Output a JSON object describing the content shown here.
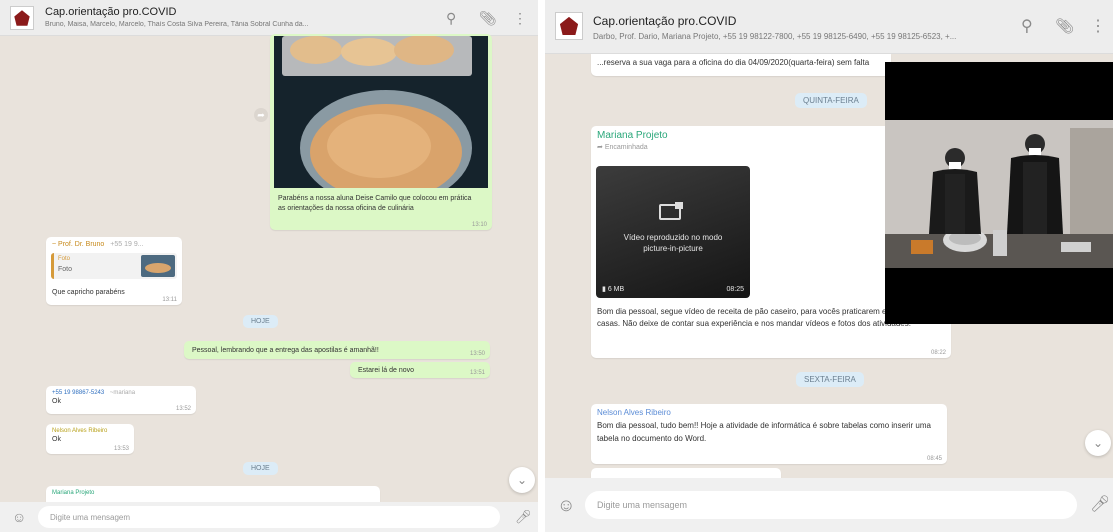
{
  "left": {
    "header": {
      "title": "Cap.orientação pro.COVID",
      "subtitle": "Bruno, Maisa, Marcelo, Marcelo, Thaís Costa Silva Pereira, Tânia Sobral Cunha da..."
    },
    "messages": {
      "photo_caption": "Parabéns a nossa aluna Deise Camilo que colocou em prática as orientações da nossa oficina de culinária",
      "photo_time": "13:10",
      "reply_sender": "~ Prof. Dr. Bruno",
      "reply_sender_phone": "+55 19 9...",
      "reply_quoted_label": "Foto",
      "reply_quoted_text": "Foto",
      "reply_text": "Que capricho parabéns",
      "reply_time": "13:11",
      "date1": "HOJE",
      "out1_text": "Pessoal, lembrando que a entrega das apostilas é amanhã!!",
      "out1_time": "13:50",
      "out2_text": "Estarei lá de novo",
      "out2_time": "13:51",
      "phone_sender": "+55 19 98867-5243",
      "phone_tag": "~mariana",
      "phone_text": "Ok",
      "phone_time": "13:52",
      "ok_sender": "Nelson Alves Ribeiro",
      "ok_text": "Ok",
      "ok_time": "13:53",
      "date2": "HOJE",
      "partial_sender": "Mariana Projeto"
    },
    "footer": {
      "placeholder": "Digite uma mensagem"
    }
  },
  "right": {
    "header": {
      "title": "Cap.orientação pro.COVID",
      "subtitle": "Darbo, Prof. Dario, Mariana Projeto, +55 19 98122-7800, +55 19 98125-6490, +55 19 98125-6523, +..."
    },
    "messages": {
      "top_text": "...reserva a sua vaga para a oficina do dia 04/09/2020(quarta-feira) sem falta",
      "date1": "QUINTA-FEIRA",
      "video_sender": "Mariana Projeto",
      "video_forwarded": "Encaminhada",
      "video_overlay": "Vídeo reproduzido no modo picture-in-picture",
      "video_size": "6 MB",
      "video_duration": "08:25",
      "video_caption": "Bom dia pessoal, segue vídeo de receita de pão caseiro, para vocês praticarem em suas casas. Não deixe de contar sua experiência e nos mandar vídeos e fotos dos atividades.",
      "video_time": "08:22",
      "date2": "SEXTA-FEIRA",
      "last_sender": "Nelson Alves Ribeiro",
      "last_text": "Bom dia pessoal, tudo bem!! Hoje a atividade de informática é sobre tabelas como inserir uma tabela no documento do Word.",
      "last_time": "08:45"
    },
    "footer": {
      "placeholder": "Digite uma mensagem"
    }
  },
  "icons": [
    "search-icon",
    "attach-icon",
    "menu-icon",
    "emoji-icon",
    "mic-icon",
    "chevron-down-icon",
    "camera-icon"
  ]
}
